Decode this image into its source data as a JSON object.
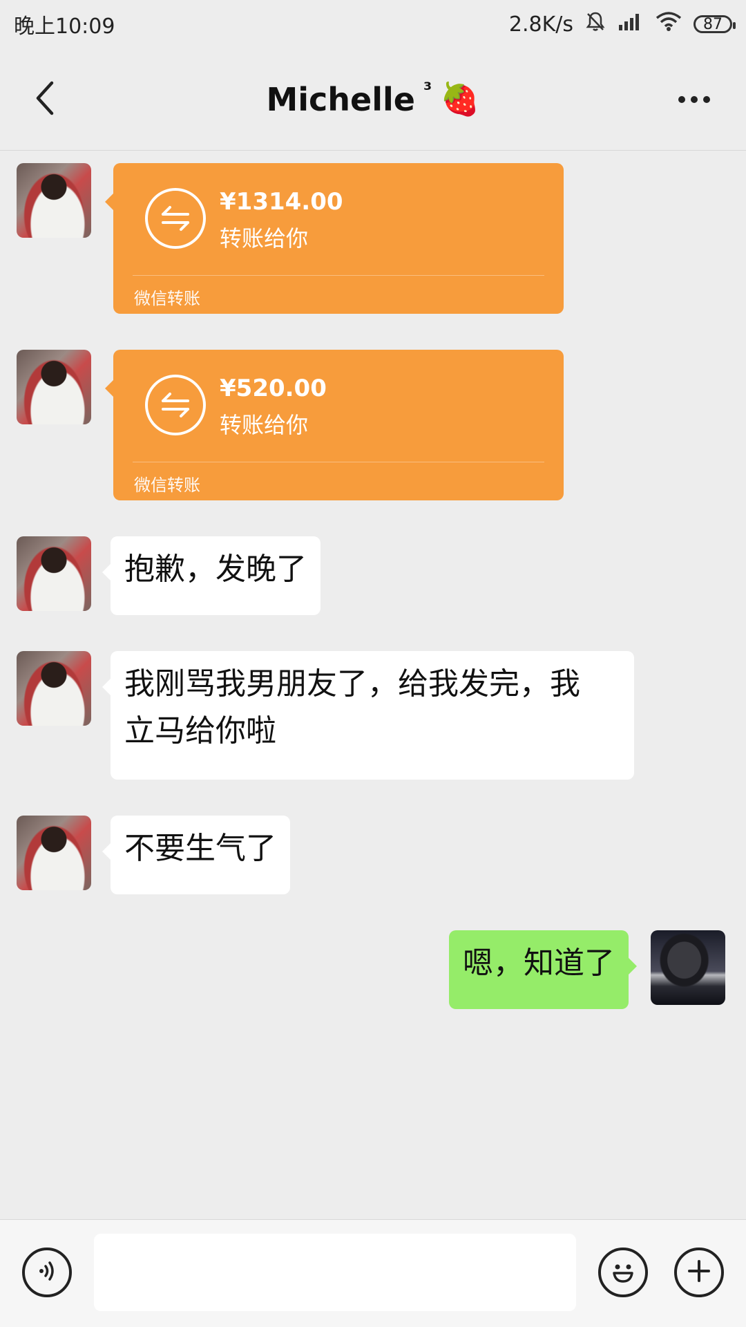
{
  "status_bar": {
    "time": "晚上10:09",
    "network_speed": "2.8K/s",
    "battery": "87",
    "icons": [
      "mute-bell-icon",
      "signal-icon",
      "wifi-icon",
      "battery-icon"
    ]
  },
  "header": {
    "title": "Michelle",
    "title_superscript": "³",
    "title_emoji": "🍓",
    "back_icon": "chevron-left-icon",
    "more_icon": "more-dots-icon"
  },
  "messages": [
    {
      "sender": "them",
      "type": "transfer",
      "amount": "¥1314.00",
      "desc": "转账给你",
      "footer": "微信转账"
    },
    {
      "sender": "them",
      "type": "transfer",
      "amount": "¥520.00",
      "desc": "转账给你",
      "footer": "微信转账"
    },
    {
      "sender": "them",
      "type": "text",
      "text": "抱歉，发晚了"
    },
    {
      "sender": "them",
      "type": "text",
      "line1": "我刚骂我男朋友了，给我发完，我",
      "line2": "立马给你啦"
    },
    {
      "sender": "them",
      "type": "text",
      "text": "不要生气了"
    },
    {
      "sender": "me",
      "type": "text",
      "text": "嗯，知道了"
    }
  ],
  "input_bar": {
    "voice_icon": "voice-icon",
    "emoji_icon": "emoji-icon",
    "plus_icon": "plus-icon",
    "placeholder": ""
  },
  "colors": {
    "transfer": "#f79c3c",
    "my_bubble": "#95ec69",
    "their_bubble": "#ffffff",
    "background": "#ededed"
  }
}
